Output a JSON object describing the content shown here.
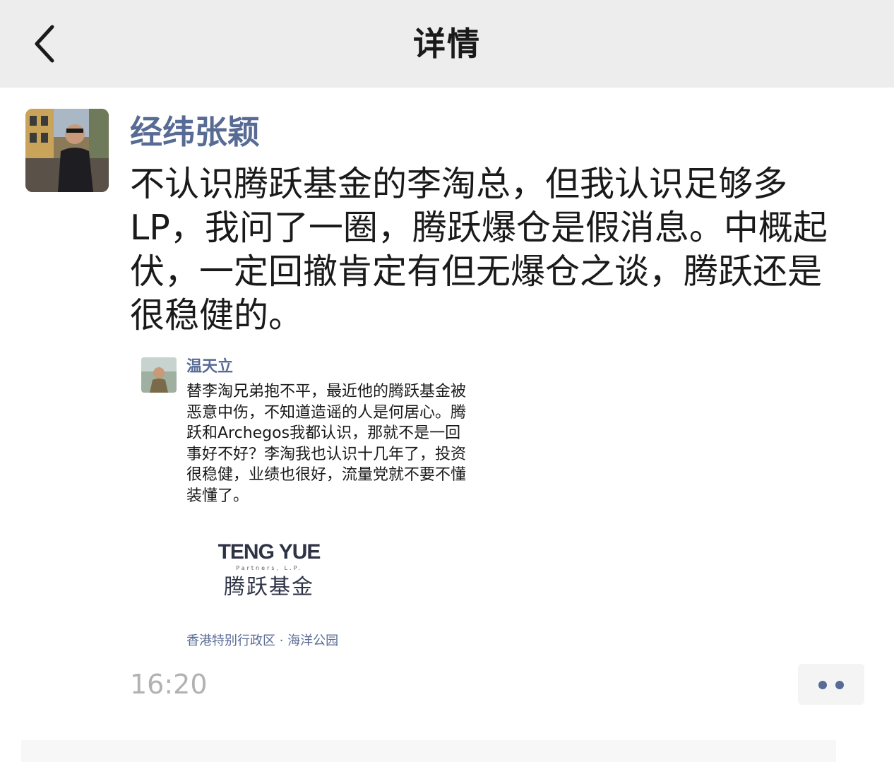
{
  "nav": {
    "title": "详情",
    "back_icon": "chevron-left-icon"
  },
  "post": {
    "author": "经纬张颖",
    "text": "不认识腾跃基金的李淘总，但我认识足够多\nLP，我问了一圈，腾跃爆仓是假消息。中概起\n伏，一定回撤肯定有但无爆仓之谈，腾跃还是\n很稳健的。",
    "timestamp": "16:20",
    "more_icon": "more-dots-icon"
  },
  "shared_image": {
    "author": "温天立",
    "text": "替李淘兄弟抱不平，最近他的腾跃基金被\n恶意中伤，不知道造谣的人是何居心。腾\n跃和Archegos我都认识，那就不是一回\n事好不好？李淘我也认识十几年了，投资\n很稳健，业绩也很好，流量党就不要不懂\n装懂了。",
    "logo": {
      "en": "TENG YUE",
      "sub": "Partners, L.P.",
      "cn": "腾跃基金"
    },
    "location": "香港特别行政区 · 海洋公园"
  },
  "colors": {
    "nav_bg": "#ededed",
    "name_link": "#586b95",
    "body_text": "#1a1a1a",
    "timestamp": "#b2b2b2"
  }
}
